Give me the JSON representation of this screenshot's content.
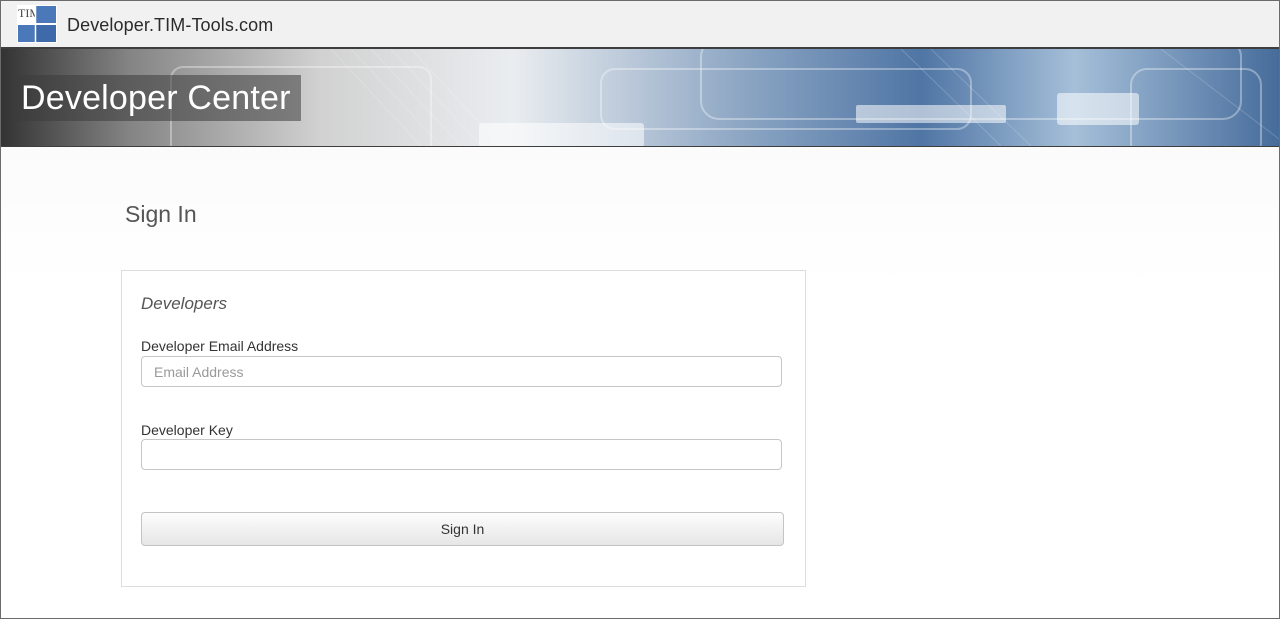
{
  "header": {
    "site_name": "Developer.TIM-Tools.com",
    "logo_text": "TIM",
    "logo_colors": [
      "#4a78b8",
      "#6f9ad0",
      "#3f6aa9"
    ]
  },
  "banner": {
    "title": "Developer Center"
  },
  "page": {
    "title": "Sign In"
  },
  "form": {
    "legend": "Developers",
    "email_label": "Developer Email Address",
    "email_placeholder": "Email Address",
    "email_value": "",
    "key_label": "Developer Key",
    "key_value": "",
    "submit_label": "Sign In"
  }
}
